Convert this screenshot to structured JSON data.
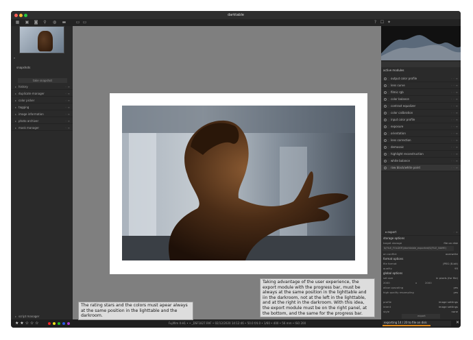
{
  "window": {
    "title": "darktable"
  },
  "left": {
    "snapshots": {
      "title": "snapshots",
      "button": "take snapshot"
    },
    "modules": [
      "history",
      "duplicate manager",
      "color picker",
      "tagging",
      "image information",
      "photo archiver",
      "mask manager"
    ],
    "bottom_module": "script manager"
  },
  "right": {
    "header": "active modules",
    "modules": [
      "output color profile",
      "lens curve",
      "filmic rgb",
      "color balance",
      "contrast equalizer",
      "color calibration",
      "input color profile",
      "exposure",
      "orientation",
      "lens correction",
      "demosaic",
      "highlight reconstruction",
      "white balance",
      "raw black/white point"
    ],
    "active_module": "raw black/white point",
    "export": {
      "title": "export",
      "storage_section": "storage options",
      "target_storage_label": "target storage",
      "target_storage_value": "file on disk",
      "path": "$(FILE_FOLDER)/darktable_exported/$(FILE_NAME)",
      "on_conflict_label": "on conflict",
      "on_conflict_value": "overwrite",
      "format_section": "format options",
      "file_format_label": "file format",
      "file_format_value": "JPEG (8-bit)",
      "quality_label": "quality",
      "quality_value": "95",
      "global_section": "global options",
      "set_size_label": "set size",
      "set_size_value": "in pixels (for file)",
      "size_w": "2000",
      "size_h": "2000",
      "allow_upscaling_label": "allow upscaling",
      "allow_upscaling_value": "yes",
      "hq_label": "high quality resampling",
      "hq_value": "yes",
      "profile_label": "profile",
      "profile_value": "image settings",
      "intent_label": "intent",
      "intent_value": "image settings",
      "style_label": "style",
      "style_value": "none",
      "export_button": "export"
    }
  },
  "bottom": {
    "stars": "★ ★ ☆ ☆ ☆",
    "color_labels": [
      "#e22",
      "#f1e51a",
      "#25c025",
      "#2a59e8",
      "#b33ad1"
    ],
    "image_info": "Fujifilm X-H1 • • _DSF1827.RAF • 02/12/2020 14:12:46 • 50.0 f/4.0 • 1/60 • 400 • 56 mm • ISO 200",
    "export_progress_text": "exporting 14 / 20 to file on disk",
    "export_progress": 0.7
  },
  "notes": {
    "left": "The rating stars and the colors must apear always at the same position in the lighttable and the darkroom.",
    "right": "Taking advantage of the user experience, the export module with the progress bar, must be always at the same position in the lighttable and iin the darkroom, not at the left in the lighttable, and at the right in the darkroom. With this idea, the export module must be on the right panel, at the bottom, and the same for the progress bar."
  }
}
